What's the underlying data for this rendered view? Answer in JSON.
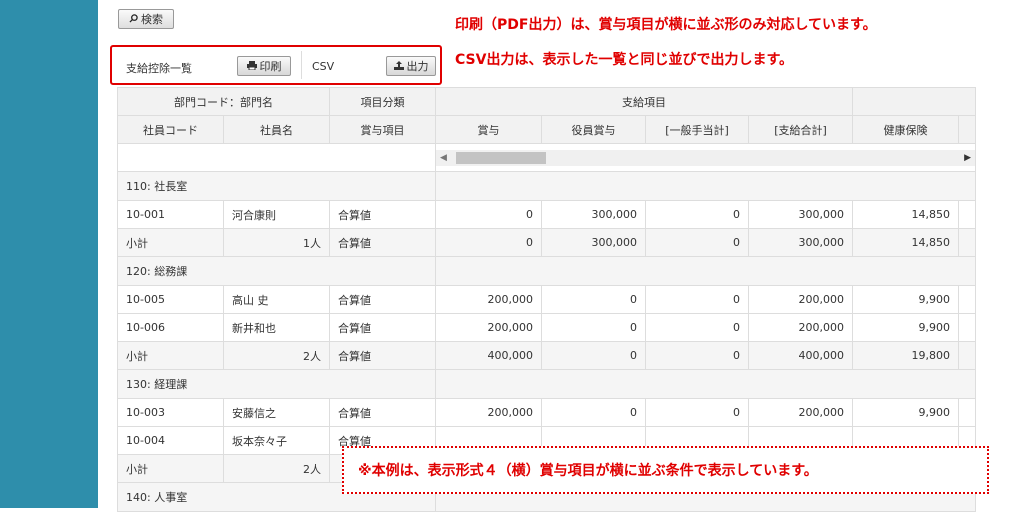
{
  "search_button": {
    "icon": "search-icon",
    "label": "検索"
  },
  "toolbar": {
    "list_label": "支給控除一覧",
    "print_button": {
      "icon": "printer-icon",
      "label": "印刷"
    },
    "csv_label": "CSV",
    "export_button": {
      "icon": "export-icon",
      "label": "出力"
    }
  },
  "notes": {
    "line1": "印刷（PDF出力）は、賞与項目が横に並ぶ形のみ対応しています。",
    "line2": "CSV出力は、表示した一覧と同じ並びで出力します。",
    "bottom": "※本例は、表示形式４（横）賞与項目が横に並ぶ条件で表示しています。"
  },
  "colors": {
    "accent": "#e00000",
    "sidebar": "#2e8eab"
  },
  "table": {
    "header1": [
      "部門コード：部門名",
      "項目分類",
      "支給項目"
    ],
    "header2": [
      "社員コード",
      "社員名",
      "賞与項目",
      "賞与",
      "役員賞与",
      "[一般手当計]",
      "[支給合計]",
      "健康保険"
    ],
    "rows": [
      {
        "type": "group",
        "label": "110: 社長室"
      },
      {
        "type": "data",
        "cells": [
          "10-001",
          "河合康則",
          "合算値",
          "0",
          "300,000",
          "0",
          "300,000",
          "14,850"
        ]
      },
      {
        "type": "subtotal",
        "cells": [
          "小計",
          "1人",
          "合算値",
          "0",
          "300,000",
          "0",
          "300,000",
          "14,850"
        ]
      },
      {
        "type": "group",
        "label": "120: 総務課"
      },
      {
        "type": "data",
        "cells": [
          "10-005",
          "高山 史",
          "合算値",
          "200,000",
          "0",
          "0",
          "200,000",
          "9,900"
        ]
      },
      {
        "type": "data",
        "cells": [
          "10-006",
          "新井和也",
          "合算値",
          "200,000",
          "0",
          "0",
          "200,000",
          "9,900"
        ]
      },
      {
        "type": "subtotal",
        "cells": [
          "小計",
          "2人",
          "合算値",
          "400,000",
          "0",
          "0",
          "400,000",
          "19,800"
        ]
      },
      {
        "type": "group",
        "label": "130: 経理課"
      },
      {
        "type": "data",
        "cells": [
          "10-003",
          "安藤信之",
          "合算値",
          "200,000",
          "0",
          "0",
          "200,000",
          "9,900"
        ]
      },
      {
        "type": "data",
        "cells": [
          "10-004",
          "坂本奈々子",
          "合算値",
          "",
          "",
          "",
          "",
          ""
        ]
      },
      {
        "type": "subtotal",
        "cells": [
          "小計",
          "2人",
          "",
          "",
          "",
          "",
          "",
          ""
        ]
      },
      {
        "type": "group",
        "label": "140: 人事室"
      }
    ]
  }
}
